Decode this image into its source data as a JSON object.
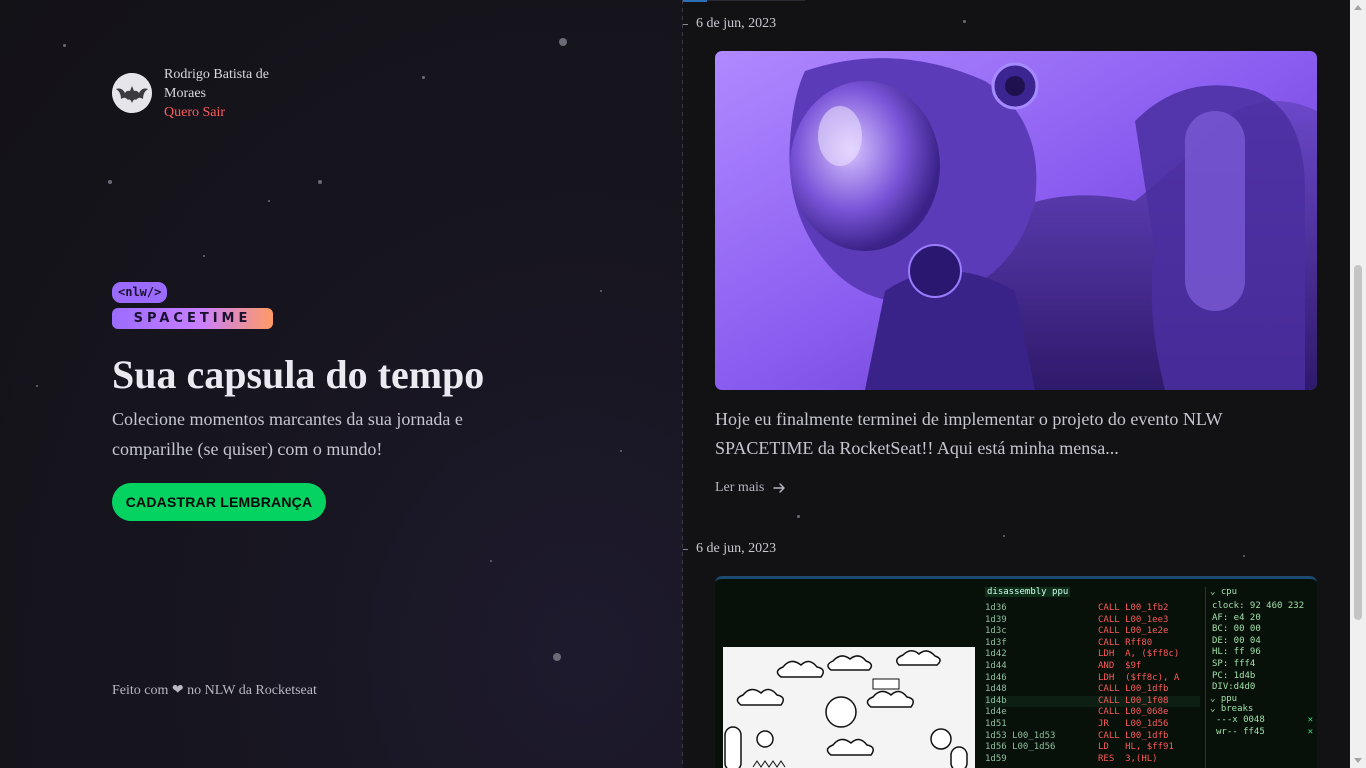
{
  "user": {
    "name": "Rodrigo Batista de Moraes",
    "logout_label": "Quero Sair"
  },
  "brand": {
    "logo_top": "<nlw/>",
    "logo_bottom": "SPACETIME"
  },
  "hero": {
    "title": "Sua capsula do tempo",
    "subtitle": "Colecione momentos marcantes da sua jornada e comparilhe (se quiser) com o mundo!",
    "cta_label": "CADASTRAR LEMBRANÇA"
  },
  "footer": {
    "before_heart": "Feito com",
    "heart_icon": "heart-icon",
    "after_heart": "no NLW da Rocketseat"
  },
  "memories": [
    {
      "date": "6 de jun, 2023",
      "excerpt": "Hoje eu finalmente terminei de implementar o projeto do evento NLW SPACETIME da RocketSeat!! Aqui está minha mensa...",
      "read_more": "Ler mais",
      "image": "astronaut-illustration"
    },
    {
      "date": "6 de jun, 2023",
      "image": "emulator-debugger-screenshot",
      "terminal": {
        "panel_title": "disassembly ppu",
        "cpu_title": "cpu",
        "addresses": [
          "1d36",
          "1d39",
          "1d3c",
          "1d3f",
          "1d42",
          "1d44",
          "1d46",
          "1d48",
          "1d4b",
          "1d4e",
          "1d51",
          "1d53 L00_1d53",
          "1d56 L00_1d56",
          "1d59"
        ],
        "ops": [
          "CALL L00_1fb2",
          "CALL L00_1ee3",
          "CALL L00_1e2e",
          "CALL Rff80",
          "LDH  A, ($ff8c)",
          "AND  $9f",
          "LDH  ($ff8c), A",
          "CALL L00_1dfb",
          "CALL L00_1f08",
          "CALL L00_068e",
          "JR   L00_1d56",
          "CALL L00_1dfb",
          "LD   HL, $ff91",
          "RES  3,(HL)"
        ],
        "registers": [
          "clock: 92 460 232",
          "AF: e4 20",
          "BC: 00 00",
          "DE: 00 04",
          "HL: ff 96",
          "SP: fff4",
          "PC: 1d4b",
          "DIV:d4d0"
        ],
        "ppu_label": "ppu",
        "breaks_label": "breaks",
        "breaks": [
          "---x 0048",
          "wr-- ff45"
        ]
      }
    }
  ],
  "colors": {
    "accent_green": "#04d361",
    "logout_red": "#ff5b5b",
    "brand_purple": "#9b6bff"
  }
}
